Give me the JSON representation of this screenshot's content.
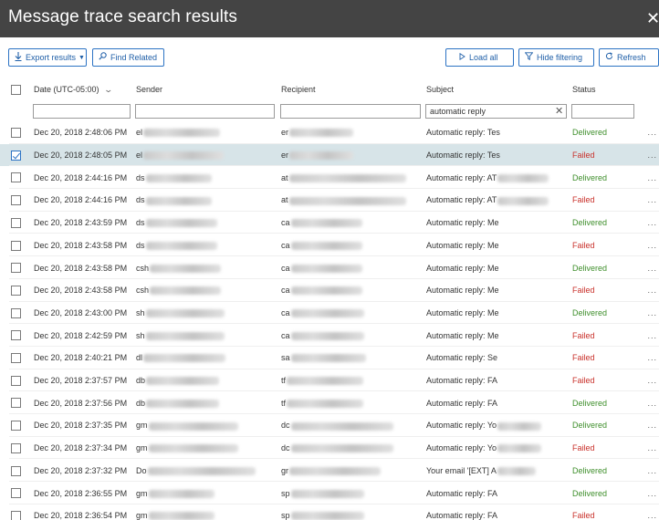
{
  "window": {
    "title": "Message trace search results",
    "close_glyph": "✕"
  },
  "toolbar": {
    "export_label": "Export results",
    "find_related_label": "Find Related",
    "load_all_label": "Load all",
    "hide_filtering_label": "Hide filtering",
    "refresh_label": "Refresh"
  },
  "columns": {
    "date": "Date (UTC-05:00)",
    "sender": "Sender",
    "recipient": "Recipient",
    "subject": "Subject",
    "status": "Status"
  },
  "filters": {
    "date": "",
    "sender": "",
    "recipient": "",
    "subject": "automatic reply",
    "status": ""
  },
  "rows": [
    {
      "date": "Dec 20, 2018 2:48:06 PM",
      "sender": "el",
      "recipient": "er",
      "subject": "Automatic reply: Tes",
      "status": "Delivered",
      "status_type": "delivered",
      "selected": false
    },
    {
      "date": "Dec 20, 2018 2:48:05 PM",
      "sender": "el",
      "recipient": "er",
      "subject": "Automatic reply: Tes",
      "status": "Failed",
      "status_type": "failed",
      "selected": true
    },
    {
      "date": "Dec 20, 2018 2:44:16 PM",
      "sender": "ds",
      "recipient": "at",
      "subject": "Automatic reply: AT",
      "status": "Delivered",
      "status_type": "delivered",
      "selected": false
    },
    {
      "date": "Dec 20, 2018 2:44:16 PM",
      "sender": "ds",
      "recipient": "at",
      "subject": "Automatic reply: AT",
      "status": "Failed",
      "status_type": "failed",
      "selected": false
    },
    {
      "date": "Dec 20, 2018 2:43:59 PM",
      "sender": "ds",
      "recipient": "ca",
      "subject": "Automatic reply: Me",
      "status": "Delivered",
      "status_type": "delivered",
      "selected": false
    },
    {
      "date": "Dec 20, 2018 2:43:58 PM",
      "sender": "ds",
      "recipient": "ca",
      "subject": "Automatic reply: Me",
      "status": "Failed",
      "status_type": "failed",
      "selected": false
    },
    {
      "date": "Dec 20, 2018 2:43:58 PM",
      "sender": "csh",
      "recipient": "ca",
      "subject": "Automatic reply: Me",
      "status": "Delivered",
      "status_type": "delivered",
      "selected": false
    },
    {
      "date": "Dec 20, 2018 2:43:58 PM",
      "sender": "csh",
      "recipient": "ca",
      "subject": "Automatic reply: Me",
      "status": "Failed",
      "status_type": "failed",
      "selected": false
    },
    {
      "date": "Dec 20, 2018 2:43:00 PM",
      "sender": "sh",
      "recipient": "ca",
      "subject": "Automatic reply: Me",
      "status": "Delivered",
      "status_type": "delivered",
      "selected": false
    },
    {
      "date": "Dec 20, 2018 2:42:59 PM",
      "sender": "sh",
      "recipient": "ca",
      "subject": "Automatic reply: Me",
      "status": "Failed",
      "status_type": "failed",
      "selected": false
    },
    {
      "date": "Dec 20, 2018 2:40:21 PM",
      "sender": "dl",
      "recipient": "sa",
      "subject": "Automatic reply: Se",
      "status": "Failed",
      "status_type": "failed",
      "selected": false
    },
    {
      "date": "Dec 20, 2018 2:37:57 PM",
      "sender": "db",
      "recipient": "tf",
      "subject": "Automatic reply: FA",
      "status": "Failed",
      "status_type": "failed",
      "selected": false
    },
    {
      "date": "Dec 20, 2018 2:37:56 PM",
      "sender": "db",
      "recipient": "tf",
      "subject": "Automatic reply: FA",
      "status": "Delivered",
      "status_type": "delivered",
      "selected": false
    },
    {
      "date": "Dec 20, 2018 2:37:35 PM",
      "sender": "gm",
      "recipient": "dc",
      "subject": "Automatic reply: Yo",
      "status": "Delivered",
      "status_type": "delivered",
      "selected": false
    },
    {
      "date": "Dec 20, 2018 2:37:34 PM",
      "sender": "gm",
      "recipient": "dc",
      "subject": "Automatic reply: Yo",
      "status": "Failed",
      "status_type": "failed",
      "selected": false
    },
    {
      "date": "Dec 20, 2018 2:37:32 PM",
      "sender": "Do",
      "recipient": "gr",
      "subject": "Your email '[EXT] A",
      "status": "Delivered",
      "status_type": "delivered",
      "selected": false
    },
    {
      "date": "Dec 20, 2018 2:36:55 PM",
      "sender": "gm",
      "recipient": "sp",
      "subject": "Automatic reply: FA",
      "status": "Delivered",
      "status_type": "delivered",
      "selected": false
    },
    {
      "date": "Dec 20, 2018 2:36:54 PM",
      "sender": "gm",
      "recipient": "sp",
      "subject": "Automatic reply: FA",
      "status": "Failed",
      "status_type": "failed",
      "selected": false
    }
  ],
  "row_more_glyph": "...",
  "colors": {
    "titlebar": "#444444",
    "accent": "#2c73c4",
    "selected_row": "#d7e4e8",
    "delivered": "#3f8f2c",
    "failed": "#c9312b"
  },
  "icons": {
    "close": "close-icon",
    "export": "download-icon",
    "find_related": "search-icon",
    "load_all": "play-icon",
    "hide_filtering": "filter-icon",
    "refresh": "refresh-icon",
    "sort": "chevron-down-icon",
    "clear_filter": "clear-icon"
  }
}
